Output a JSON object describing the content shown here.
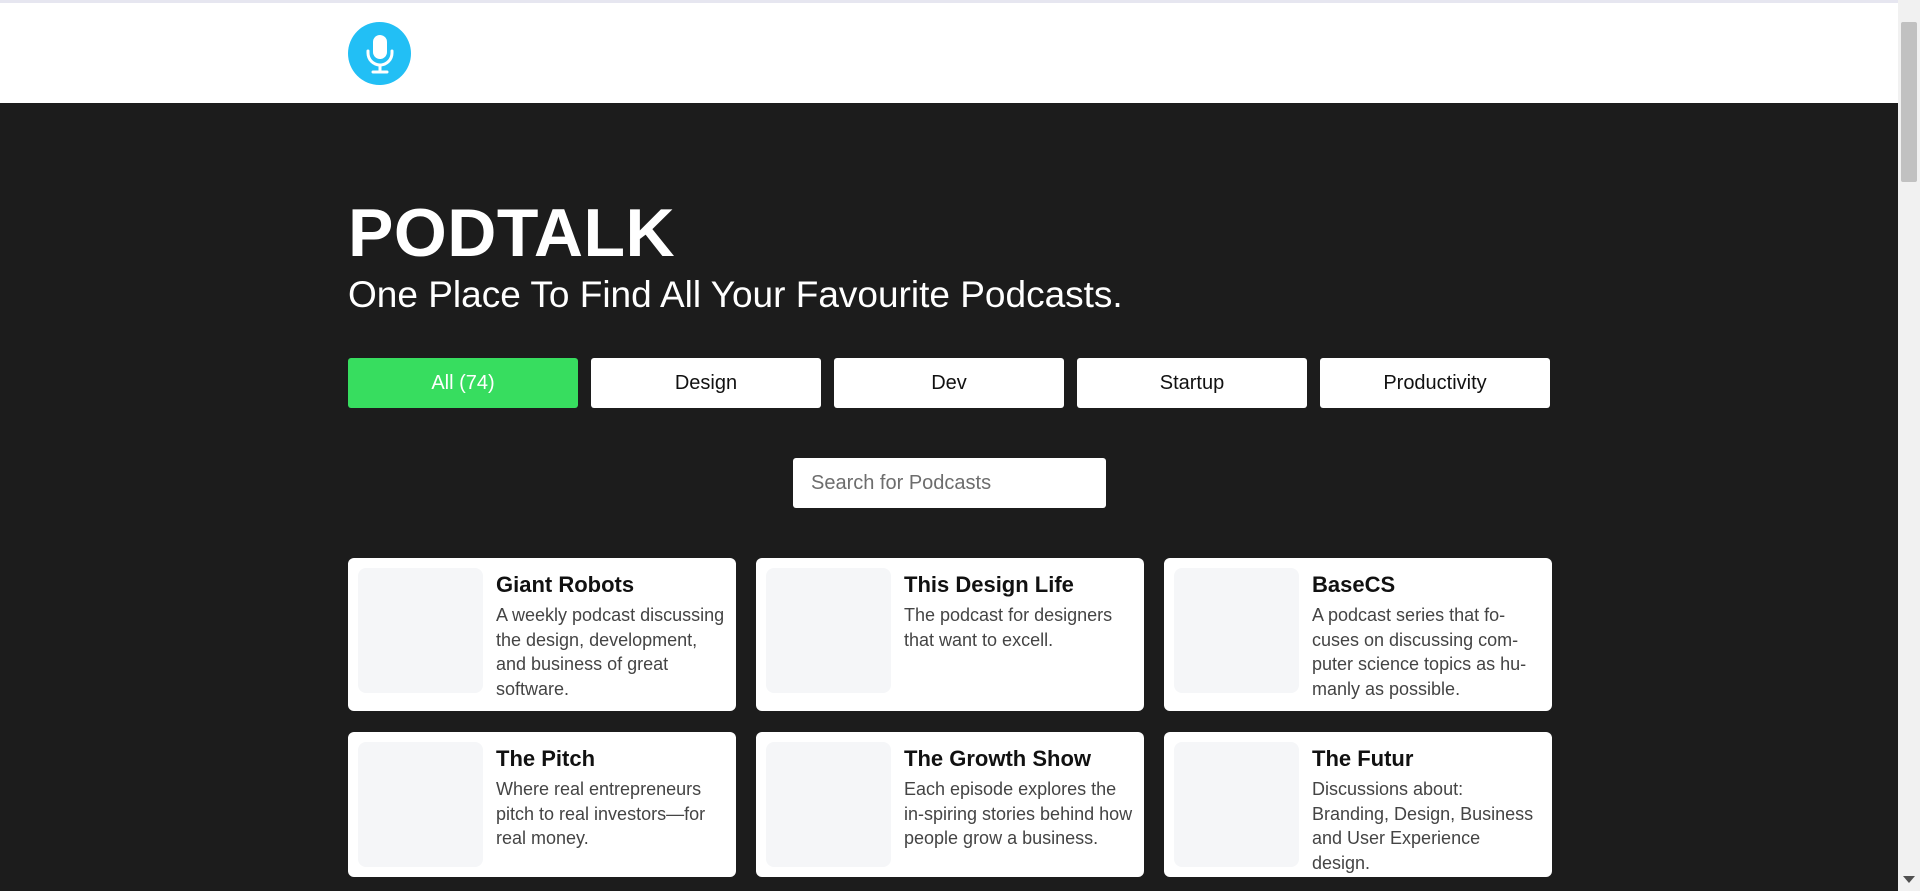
{
  "brand": {
    "logo_icon": "microphone-icon",
    "logo_color": "#22bff5",
    "title": "PODTALK",
    "tagline": "One Place To Find All Your Favourite Podcasts."
  },
  "filters": [
    {
      "label": "All (74)",
      "active": true
    },
    {
      "label": "Design",
      "active": false
    },
    {
      "label": "Dev",
      "active": false
    },
    {
      "label": "Startup",
      "active": false
    },
    {
      "label": "Productivity",
      "active": false
    }
  ],
  "search": {
    "placeholder": "Search for Podcasts",
    "value": ""
  },
  "podcasts": [
    {
      "title": "Giant Robots",
      "description": "A weekly podcast discussing the design, development, and business of great software."
    },
    {
      "title": "This Design Life",
      "description": "The podcast for designers that want to excell."
    },
    {
      "title": "BaseCS",
      "description": "A podcast series that fo-cuses on discussing com-puter science topics as hu-manly as possible."
    },
    {
      "title": "The Pitch",
      "description": "Where real entrepreneurs pitch to real investors—for real money."
    },
    {
      "title": "The Growth Show",
      "description": "Each episode explores the in-spiring stories behind how people grow a business."
    },
    {
      "title": "The Futur",
      "description": "Discussions about: Branding, Design, Business and User Experience design."
    }
  ],
  "colors": {
    "background": "#1c1c1c",
    "accent": "#37dd5f",
    "card": "#ffffff"
  }
}
